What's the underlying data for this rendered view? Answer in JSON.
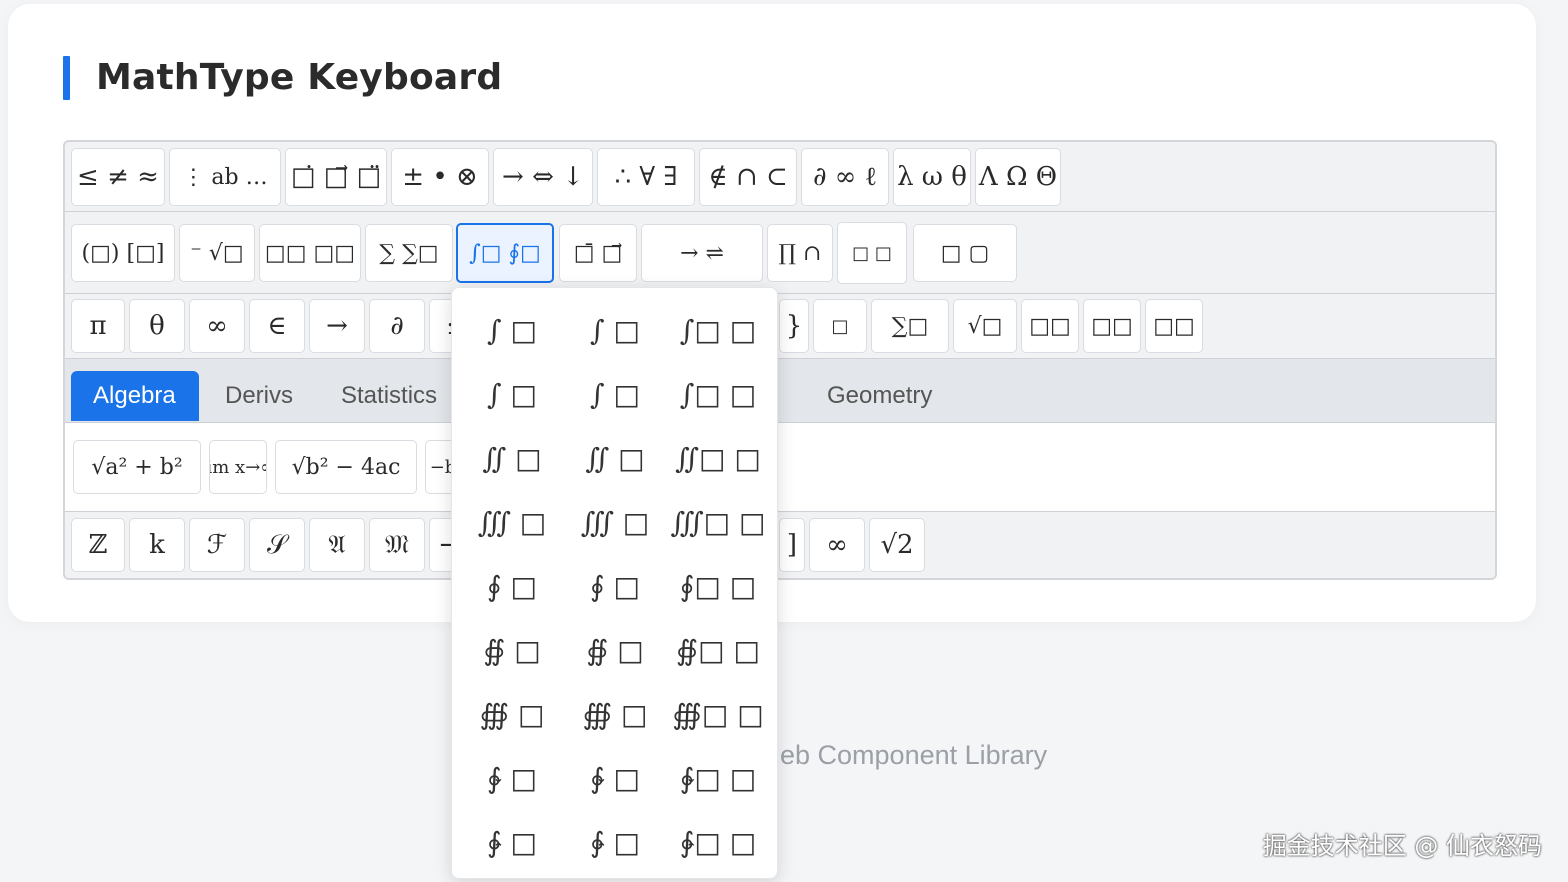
{
  "title": "MathType Keyboard",
  "row1": [
    "≤ ≠ ≈",
    "⋮ ab …",
    "□̇ □⃗ □̈",
    "± • ⊗",
    "→ ⇔ ↓",
    "∴ ∀ ∃",
    "∉ ∩ ⊂",
    "∂ ∞ ℓ",
    "λ ω θ",
    "Λ Ω Θ"
  ],
  "row2": [
    "(□) [□]",
    "⁻ √□",
    "□□ □□",
    "∑ ∑□",
    "∫□ ∮□",
    "□̄ □⃗",
    "→ ⇌",
    "∏ ∩",
    "□ □",
    "□ ▢"
  ],
  "row3": [
    "π",
    "θ",
    "∞",
    "∈",
    "→",
    "∂",
    "≤",
    "}",
    "□",
    "∑□",
    "√□",
    "□□",
    "□□",
    "□□"
  ],
  "tabs": [
    "Algebra",
    "Derivs",
    "Statistics",
    "Geometry"
  ],
  "row5": [
    "√a² + b²",
    "lim x→∞",
    "√b² − 4ac",
    "−b"
  ],
  "row6": [
    "ℤ",
    "k",
    "ℱ",
    "𝒮",
    "𝔄",
    "𝔐",
    "−",
    "]",
    "∞",
    "√2"
  ],
  "popup": [
    "∫ □",
    "∫ □",
    "∫□ □",
    "∫ □",
    "∫ □",
    "∫□ □",
    "∬ □",
    "∬ □",
    "∬□ □",
    "∭ □",
    "∭ □",
    "∭□ □",
    "∮ □",
    "∮ □",
    "∮□ □",
    "∯ □",
    "∯ □",
    "∯□ □",
    "∰ □",
    "∰ □",
    "∰□ □",
    "∲ □",
    "∲ □",
    "∲□ □",
    "∳ □",
    "∳ □",
    "∳□ □"
  ],
  "footer": "eb Component Library",
  "watermark": "掘金技术社区 @ 仙衣怒码",
  "colors": {
    "accent": "#1a73e8",
    "tab_bg": "#e3e6ea"
  }
}
